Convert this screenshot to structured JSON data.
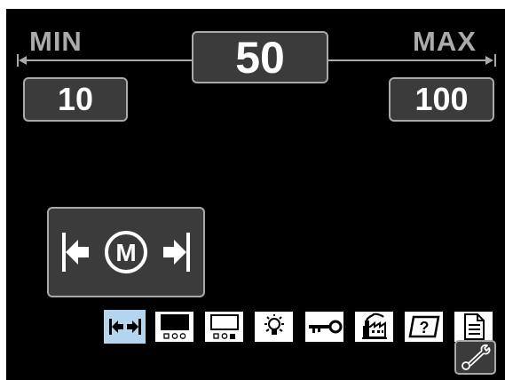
{
  "range": {
    "min_label": "MIN",
    "max_label": "MAX",
    "current_value": "50",
    "min_value": "10",
    "max_value": "100"
  },
  "feature_panel": {
    "icon": "motor-limits-icon",
    "glyph": "M"
  },
  "toolbar": {
    "items": [
      {
        "icon": "motor-limits-icon",
        "selected": true
      },
      {
        "icon": "display-layout-circles-icon",
        "selected": false
      },
      {
        "icon": "display-layout-squares-icon",
        "selected": false
      },
      {
        "icon": "brightness-icon",
        "selected": false
      },
      {
        "icon": "key-lock-icon",
        "selected": false
      },
      {
        "icon": "factory-reset-icon",
        "selected": false
      },
      {
        "icon": "help-screen-icon",
        "selected": false
      },
      {
        "icon": "document-icon",
        "selected": false
      }
    ],
    "help_glyph": "?"
  },
  "settings": {
    "icon": "wrench-icon"
  },
  "colors": {
    "background": "#000000",
    "box": "#3b3b3b",
    "border": "#a9a9a9",
    "selected": "#b3d5ee"
  }
}
